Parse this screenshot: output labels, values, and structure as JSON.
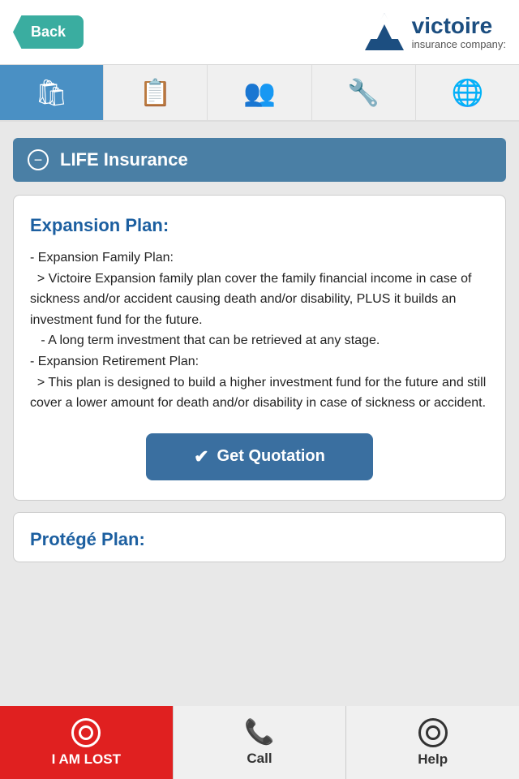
{
  "header": {
    "back_label": "Back",
    "logo_name": "victoire",
    "logo_sub": "insurance company:"
  },
  "nav": {
    "tabs": [
      {
        "id": "shop",
        "icon": "🛍",
        "active": true
      },
      {
        "id": "docs",
        "icon": "📋",
        "active": false
      },
      {
        "id": "people",
        "icon": "👥",
        "active": false
      },
      {
        "id": "tools",
        "icon": "🔧",
        "active": false
      },
      {
        "id": "globe",
        "icon": "🌐",
        "active": false
      }
    ]
  },
  "section": {
    "title": "LIFE Insurance"
  },
  "expansion_plan": {
    "title": "Expansion Plan:",
    "body": "- Expansion Family Plan:\n  > Victoire Expansion family plan cover the family financial income in case of sickness and/or accident causing death and/or disability, PLUS it builds an investment fund for the future.\n   - A long term investment that can be retrieved at any stage.\n- Expansion Retirement Plan:\n  > This plan is designed to build a higher investment fund for the future and still cover a lower amount for death and/or disability in case of sickness or accident.",
    "quotation_btn": "Get Quotation"
  },
  "protege_plan": {
    "title": "Protégé Plan:"
  },
  "bottom_bar": {
    "lost_label": "I AM LOST",
    "call_label": "Call",
    "help_label": "Help"
  }
}
